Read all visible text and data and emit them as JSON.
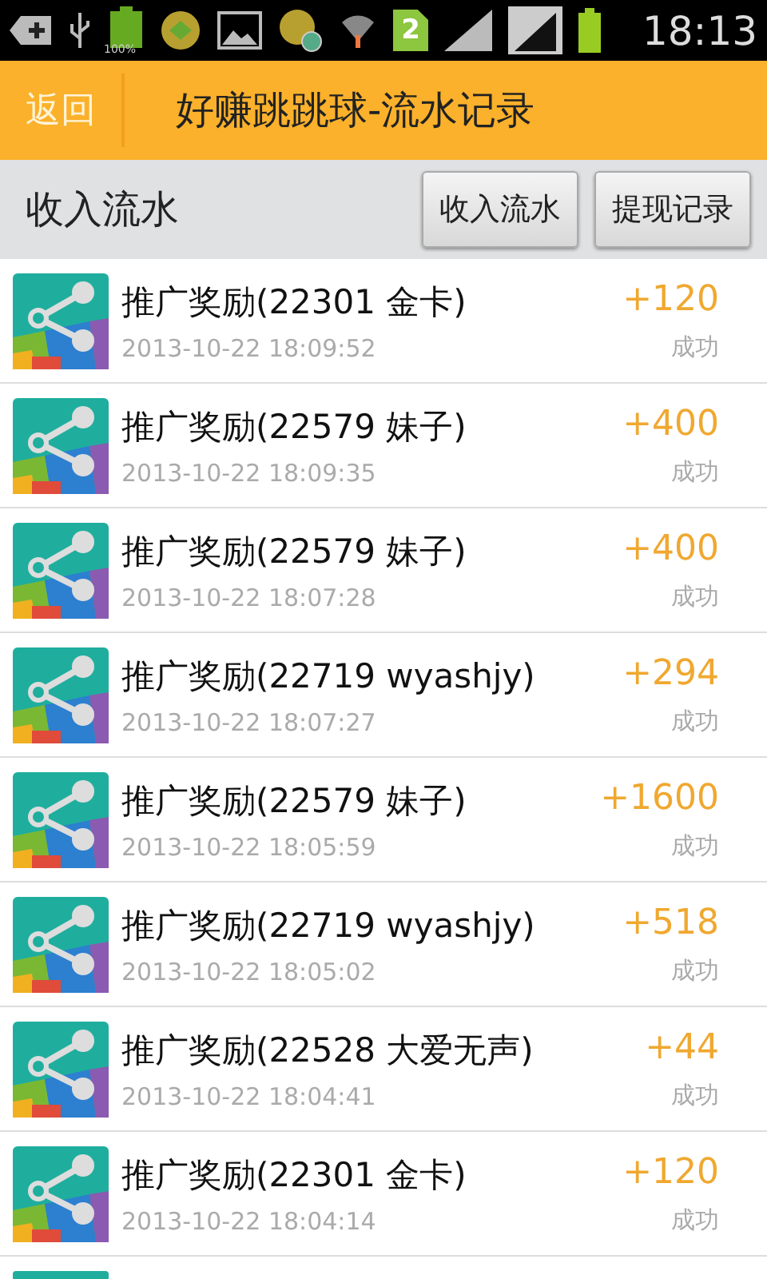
{
  "status_bar": {
    "battery_label": "100%",
    "sim_number": "2",
    "time": "18:13"
  },
  "header": {
    "back": "返回",
    "title": "好赚跳跳球-流水记录"
  },
  "subheader": {
    "title": "收入流水",
    "buttons": [
      {
        "label": "收入流水"
      },
      {
        "label": "提现记录"
      }
    ]
  },
  "records": [
    {
      "title": "推广奖励(22301 金卡)",
      "time": "2013-10-22 18:09:52",
      "amount": "+120",
      "status": "成功"
    },
    {
      "title": "推广奖励(22579 妹子)",
      "time": "2013-10-22 18:09:35",
      "amount": "+400",
      "status": "成功"
    },
    {
      "title": "推广奖励(22579 妹子)",
      "time": "2013-10-22 18:07:28",
      "amount": "+400",
      "status": "成功"
    },
    {
      "title": "推广奖励(22719 wyashjy)",
      "time": "2013-10-22 18:07:27",
      "amount": "+294",
      "status": "成功"
    },
    {
      "title": "推广奖励(22579 妹子)",
      "time": "2013-10-22 18:05:59",
      "amount": "+1600",
      "status": "成功"
    },
    {
      "title": "推广奖励(22719 wyashjy)",
      "time": "2013-10-22 18:05:02",
      "amount": "+518",
      "status": "成功"
    },
    {
      "title": "推广奖励(22528 大爱无声)",
      "time": "2013-10-22 18:04:41",
      "amount": "+44",
      "status": "成功"
    },
    {
      "title": "推广奖励(22301 金卡)",
      "time": "2013-10-22 18:04:14",
      "amount": "+120",
      "status": "成功"
    }
  ]
}
